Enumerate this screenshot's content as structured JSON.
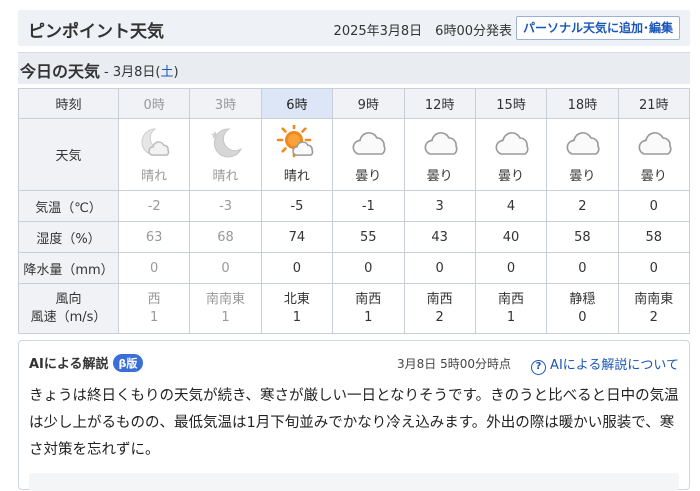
{
  "header": {
    "title": "ピンポイント天気",
    "issued": "2025年3月8日　6時00分発表",
    "add_button": "パーソナル天気に追加･編集"
  },
  "today": {
    "title": "今日の天気",
    "date_prefix": "- 3月8日(",
    "weekday": "土",
    "date_suffix": ")"
  },
  "table": {
    "labels": {
      "time": "時刻",
      "weather": "天気",
      "temp": "気温（℃）",
      "humidity": "湿度（%）",
      "precip": "降水量（mm）",
      "wind_dir": "風向",
      "wind_speed": "風速（m/s）"
    },
    "hours": [
      {
        "time": "0時",
        "icon": "moon-cloud-icon",
        "weather": "晴れ",
        "temp": "-2",
        "humidity": "63",
        "precip": "0",
        "wind_dir": "西",
        "wind_speed": "1"
      },
      {
        "time": "3時",
        "icon": "moon-star-icon",
        "weather": "晴れ",
        "temp": "-3",
        "humidity": "68",
        "precip": "0",
        "wind_dir": "南南東",
        "wind_speed": "1"
      },
      {
        "time": "6時",
        "icon": "sun-cloud-icon",
        "weather": "晴れ",
        "temp": "-5",
        "humidity": "74",
        "precip": "0",
        "wind_dir": "北東",
        "wind_speed": "1"
      },
      {
        "time": "9時",
        "icon": "cloud-icon",
        "weather": "曇り",
        "temp": "-1",
        "humidity": "55",
        "precip": "0",
        "wind_dir": "南西",
        "wind_speed": "1"
      },
      {
        "time": "12時",
        "icon": "cloud-icon",
        "weather": "曇り",
        "temp": "3",
        "humidity": "43",
        "precip": "0",
        "wind_dir": "南西",
        "wind_speed": "2"
      },
      {
        "time": "15時",
        "icon": "cloud-icon",
        "weather": "曇り",
        "temp": "4",
        "humidity": "40",
        "precip": "0",
        "wind_dir": "南西",
        "wind_speed": "1"
      },
      {
        "time": "18時",
        "icon": "cloud-icon",
        "weather": "曇り",
        "temp": "2",
        "humidity": "58",
        "precip": "0",
        "wind_dir": "静穏",
        "wind_speed": "0"
      },
      {
        "time": "21時",
        "icon": "cloud-icon",
        "weather": "曇り",
        "temp": "0",
        "humidity": "58",
        "precip": "0",
        "wind_dir": "南南東",
        "wind_speed": "2"
      }
    ]
  },
  "ai": {
    "title": "AIによる解説",
    "badge": "β版",
    "time": "3月8日 5時00分時点",
    "about_link": "AIによる解説について",
    "body": "きょうは終日くもりの天気が続き、寒さが厳しい一日となりそうです。きのうと比べると日中の気温は少し上がるものの、最低気温は1月下旬並みでかなり冷え込みます。外出の際は暖かい服装で、寒さ対策を忘れずに。"
  },
  "colors": {
    "accent": "#1a56b8",
    "current_column": "#dde6f6",
    "past_text": "#999999",
    "sun": "#f08a1c"
  }
}
